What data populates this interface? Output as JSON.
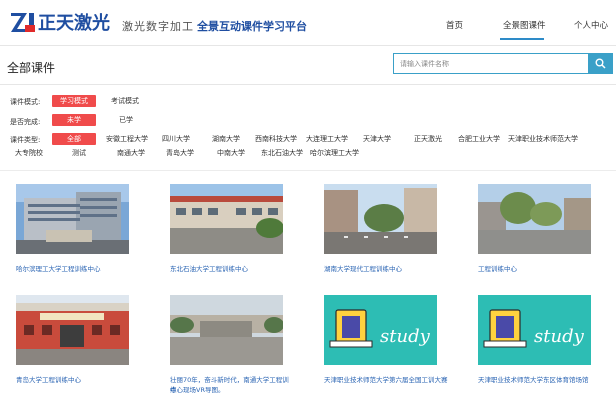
{
  "header": {
    "logo_text": "正天激光",
    "slogan": "激光数字加工",
    "platform": "全景互动课件学习平台",
    "nav": [
      "首页",
      "全景图课件",
      "个人中心"
    ]
  },
  "main": {
    "title": "全部课件",
    "search": {
      "placeholder": "请输入课件名称"
    }
  },
  "filters": {
    "mode": {
      "label": "课件模式:",
      "options": [
        "学习模式",
        "考试模式"
      ],
      "selected": "学习模式"
    },
    "done": {
      "label": "是否完成:",
      "options": [
        "未学",
        "已学"
      ],
      "selected": "未学"
    },
    "type": {
      "label": "课件类型:",
      "row1": [
        "全部",
        "安徽工程大学",
        "四川大学",
        "湖南大学",
        "西南科技大学",
        "大连理工大学",
        "天津大学",
        "正天激光",
        "合肥工业大学",
        "天津职业技术师范大学"
      ],
      "row2": [
        "大专院校",
        "测试",
        "南通大学",
        "青岛大学",
        "中南大学",
        "东北石油大学",
        "哈尔滨理工大学"
      ],
      "selected": "全部"
    }
  },
  "courses": [
    {
      "title": "哈尔滨理工大学工程训练中心",
      "image": "building-photo"
    },
    {
      "title": "东北石油大学工程训练中心",
      "image": "building-photo"
    },
    {
      "title": "湖南大学现代工程训练中心",
      "image": "campus-photo"
    },
    {
      "title": "工程训练中心",
      "image": "campus-photo"
    },
    {
      "title": "青岛大学工程训练中心",
      "image": "building-photo"
    },
    {
      "title": "壮丽70年，奋斗新时代，南通大学工程训练",
      "title2": "中心现场VR导图。",
      "image": "monument-photo"
    },
    {
      "title": "天津职业技术师范大学第六届全国工训大赛",
      "image": "study-illustration",
      "study_label": "study"
    },
    {
      "title": "天津职业技术师范大学东区体育馆场馆",
      "image": "study-illustration",
      "study_label": "study"
    }
  ],
  "colors": {
    "accent": "#3aa0c8",
    "active": "#f04b4b",
    "brand": "#1f4ea1",
    "link": "#2a64b3"
  }
}
